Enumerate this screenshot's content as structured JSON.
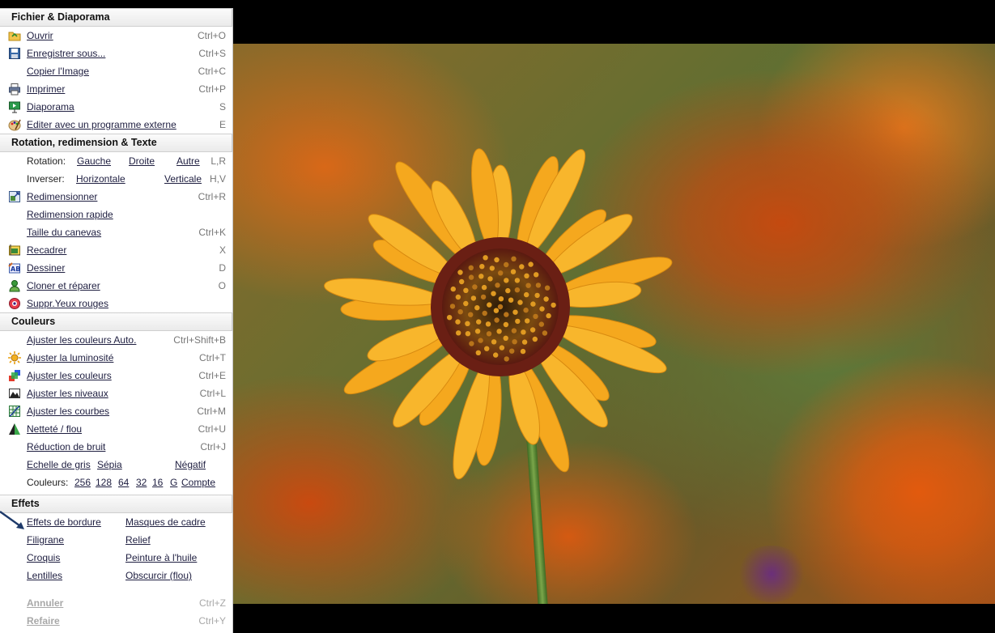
{
  "sections": {
    "fichier": {
      "title": "Fichier & Diaporama",
      "items": [
        {
          "label": "Ouvrir",
          "shortcut": "Ctrl+O",
          "icon": "folder-open-icon"
        },
        {
          "label": "Enregistrer sous...",
          "shortcut": "Ctrl+S",
          "icon": "save-icon"
        },
        {
          "label": "Copier l'Image",
          "shortcut": "Ctrl+C"
        },
        {
          "label": "Imprimer",
          "shortcut": "Ctrl+P",
          "icon": "printer-icon"
        },
        {
          "label": "Diaporama",
          "shortcut": "S",
          "icon": "slideshow-icon"
        },
        {
          "label": "Editer avec un programme externe",
          "shortcut": "E",
          "icon": "palette-icon"
        }
      ]
    },
    "rotation": {
      "title": "Rotation, redimension & Texte",
      "rotation_label": "Rotation:",
      "rotation_opts": [
        "Gauche",
        "Droite",
        "Autre"
      ],
      "rotation_sc": "L,R",
      "flip_label": "Inverser:",
      "flip_opts": [
        "Horizontale",
        "Verticale"
      ],
      "flip_sc": "H,V",
      "items": [
        {
          "label": "Redimensionner",
          "shortcut": "Ctrl+R",
          "icon": "resize-icon"
        },
        {
          "label": "Redimension rapide",
          "shortcut": ""
        },
        {
          "label": "Taille du canevas",
          "shortcut": "Ctrl+K"
        },
        {
          "label": "Recadrer",
          "shortcut": "X",
          "icon": "crop-icon"
        },
        {
          "label": "Dessiner",
          "shortcut": "D",
          "icon": "draw-icon"
        },
        {
          "label": "Cloner et réparer",
          "shortcut": "O",
          "icon": "clone-icon"
        },
        {
          "label": "Suppr.Yeux rouges",
          "shortcut": "",
          "icon": "red-eye-icon"
        }
      ]
    },
    "couleurs": {
      "title": "Couleurs",
      "items": [
        {
          "label": "Ajuster les couleurs Auto.",
          "shortcut": "Ctrl+Shift+B"
        },
        {
          "label": "Ajuster la luminosité",
          "shortcut": "Ctrl+T",
          "icon": "brightness-icon"
        },
        {
          "label": "Ajuster les couleurs",
          "shortcut": "Ctrl+E",
          "icon": "color-balance-icon"
        },
        {
          "label": "Ajuster les niveaux",
          "shortcut": "Ctrl+L",
          "icon": "levels-icon"
        },
        {
          "label": "Ajuster les courbes",
          "shortcut": "Ctrl+M",
          "icon": "curves-icon"
        },
        {
          "label": "Netteté / flou",
          "shortcut": "Ctrl+U",
          "icon": "sharpen-icon"
        },
        {
          "label": "Réduction de bruit",
          "shortcut": "Ctrl+J"
        }
      ],
      "gray": [
        "Echelle de gris",
        "Sépia",
        "Négatif"
      ],
      "colors_label": "Couleurs:",
      "colors_opts": [
        "256",
        "128",
        "64",
        "32",
        "16",
        "G",
        "Compte"
      ]
    },
    "effets": {
      "title": "Effets",
      "rows": [
        [
          "Effets de bordure",
          "Masques de cadre"
        ],
        [
          "Filigrane",
          "Relief"
        ],
        [
          "Croquis",
          "Peinture à l'huile"
        ],
        [
          "Lentilles",
          "Obscurcir (flou)"
        ]
      ]
    },
    "history": [
      {
        "label": "Annuler",
        "shortcut": "Ctrl+Z"
      },
      {
        "label": "Refaire",
        "shortcut": "Ctrl+Y"
      }
    ]
  }
}
